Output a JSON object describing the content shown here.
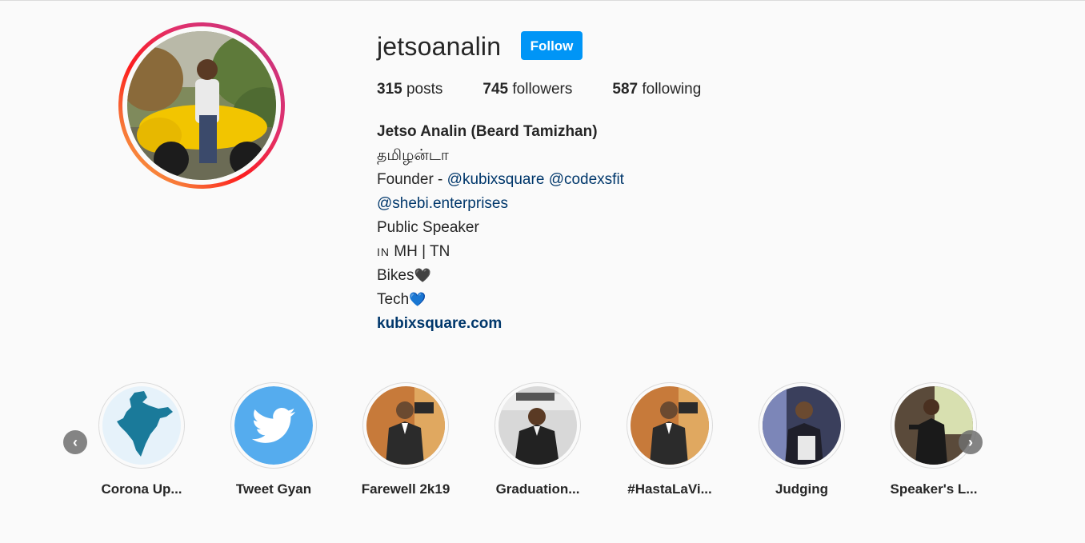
{
  "profile": {
    "username": "jetsoanalin",
    "follow_label": "Follow",
    "stats": {
      "posts_count": "315",
      "posts_label": "posts",
      "followers_count": "745",
      "followers_label": "followers",
      "following_count": "587",
      "following_label": "following"
    },
    "bio": {
      "full_name": "Jetso Analin (Beard Tamizhan)",
      "line_tamil": "தமிழன்டா",
      "founder_prefix": "Founder - ",
      "mention_1": "@kubixsquare",
      "mention_2": "@codexsfit",
      "mention_3": "@shebi.enterprises",
      "public_speaker": "Public Speaker",
      "flag_text": "IN",
      "location": " MH | TN",
      "bikes": "Bikes",
      "bikes_heart": "🖤",
      "tech": "Tech",
      "tech_heart": "💙",
      "website": "kubixsquare.com"
    }
  },
  "highlights": [
    {
      "label": "Corona Up...",
      "icon": "india-map"
    },
    {
      "label": "Tweet Gyan",
      "icon": "twitter-bird"
    },
    {
      "label": "Farewell 2k19",
      "icon": "person-suit"
    },
    {
      "label": "Graduation...",
      "icon": "person-graduation"
    },
    {
      "label": "#HastaLaVi...",
      "icon": "person-suit"
    },
    {
      "label": "Judging",
      "icon": "person-judging"
    },
    {
      "label": "Speaker's L...",
      "icon": "person-speaking"
    }
  ],
  "nav": {
    "prev": "‹",
    "next": "›"
  },
  "colors": {
    "accent": "#0095f6",
    "link": "#00376b",
    "background": "#fafafa",
    "text": "#262626"
  }
}
